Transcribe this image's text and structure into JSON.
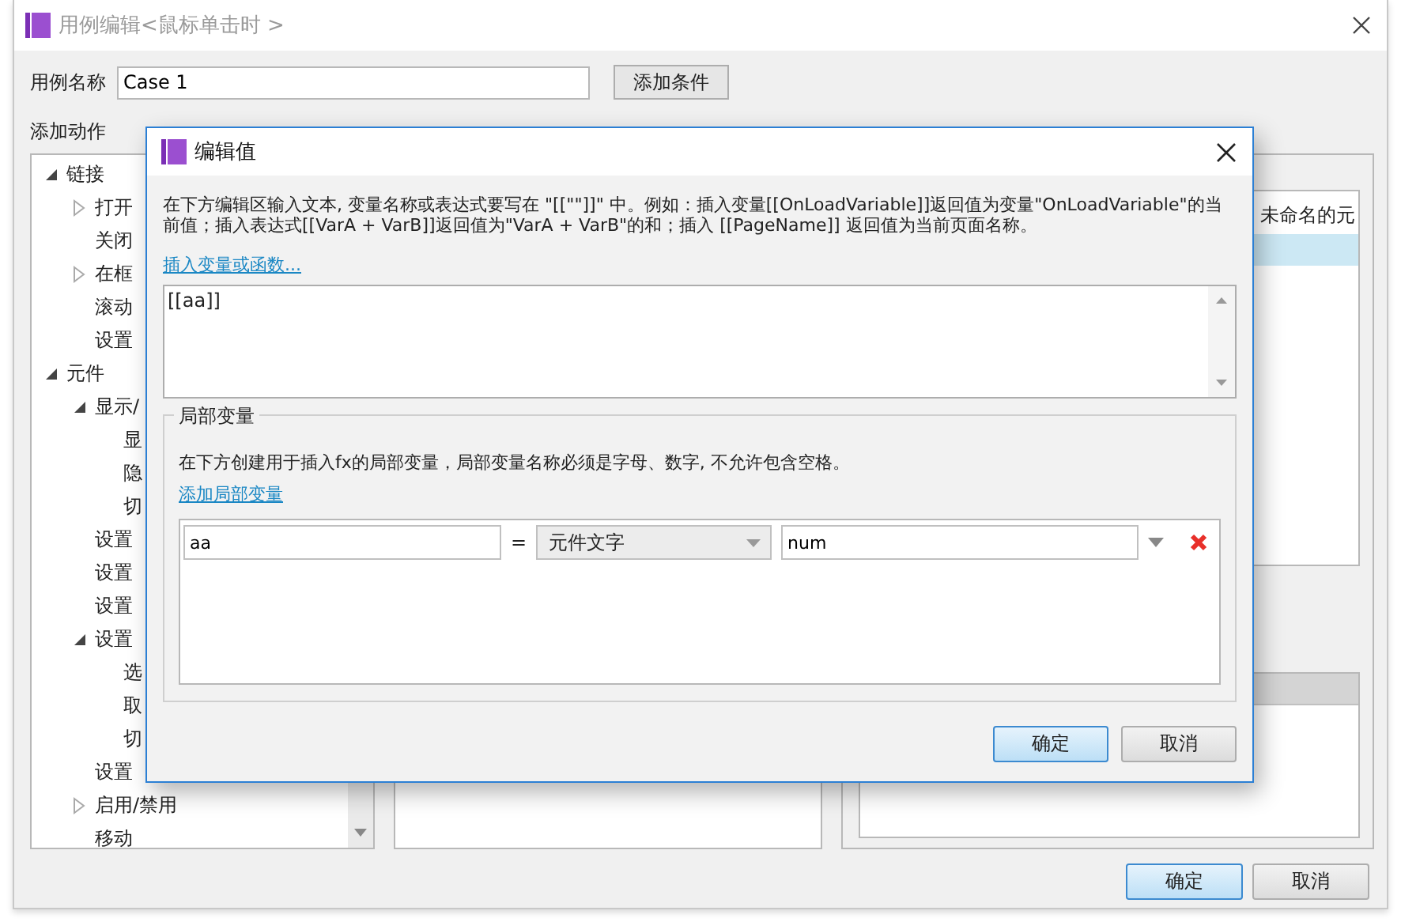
{
  "window": {
    "title": "用例编辑<鼠标单击时 >"
  },
  "case_name": {
    "label": "用例名称",
    "value": "Case 1"
  },
  "add_condition_button": "添加条件",
  "actions_panel": {
    "title": "添加动作",
    "tree": [
      {
        "label": "链接",
        "kind": "group",
        "expanded": true,
        "children": [
          {
            "label": "打开",
            "kind": "group",
            "expanded": false
          },
          {
            "label": "关闭",
            "kind": "action"
          },
          {
            "label": "在框",
            "kind": "group",
            "expanded": false
          },
          {
            "label": "滚动",
            "kind": "action"
          },
          {
            "label": "设置",
            "kind": "action"
          }
        ]
      },
      {
        "label": "元件",
        "kind": "group",
        "expanded": true,
        "children": [
          {
            "label": "显示/",
            "kind": "group",
            "expanded": true,
            "children": [
              {
                "label": "显",
                "kind": "action"
              },
              {
                "label": "隐",
                "kind": "action"
              },
              {
                "label": "切",
                "kind": "action"
              }
            ]
          },
          {
            "label": "设置",
            "kind": "action"
          },
          {
            "label": "设置",
            "kind": "action"
          },
          {
            "label": "设置",
            "kind": "action"
          },
          {
            "label": "设置",
            "kind": "group",
            "expanded": true,
            "children": [
              {
                "label": "选",
                "kind": "action"
              },
              {
                "label": "取",
                "kind": "action"
              },
              {
                "label": "切",
                "kind": "action"
              }
            ]
          },
          {
            "label": "设置",
            "kind": "action"
          },
          {
            "label": "启用/禁用",
            "kind": "group",
            "expanded": false
          },
          {
            "label": "移动",
            "kind": "action"
          }
        ]
      }
    ]
  },
  "configure_panel": {
    "rows": [
      {
        "label": "未命名的元",
        "selected": false
      },
      {
        "selected": true
      }
    ]
  },
  "buttons": [
    {
      "label": "确定",
      "default": true
    },
    {
      "label": "取消",
      "default": false
    }
  ],
  "dialog": {
    "title": "编辑值",
    "description": "在下方编辑区输入文本, 变量名称或表达式要写在 \"[[\"\"]]\" 中。例如：插入变量[[OnLoadVariable]]返回值为变量\"OnLoadVariable\"的当前值；插入表达式[[VarA + VarB]]返回值为\"VarA + VarB\"的和；插入 [[PageName]] 返回值为当前页面名称。",
    "insert_link": "插入变量或函数...",
    "expression": "[[aa]]",
    "local_variables": {
      "title": "局部变量",
      "hint": "在下方创建用于插入fx的局部变量，局部变量名称必须是字母、数字, 不允许包含空格。",
      "add_link": "添加局部变量",
      "rows": [
        {
          "name": "aa",
          "operator": "=",
          "source": "元件文字",
          "target": "num"
        }
      ]
    },
    "buttons": [
      {
        "label": "确定",
        "default": true
      },
      {
        "label": "取消",
        "default": false
      }
    ]
  }
}
